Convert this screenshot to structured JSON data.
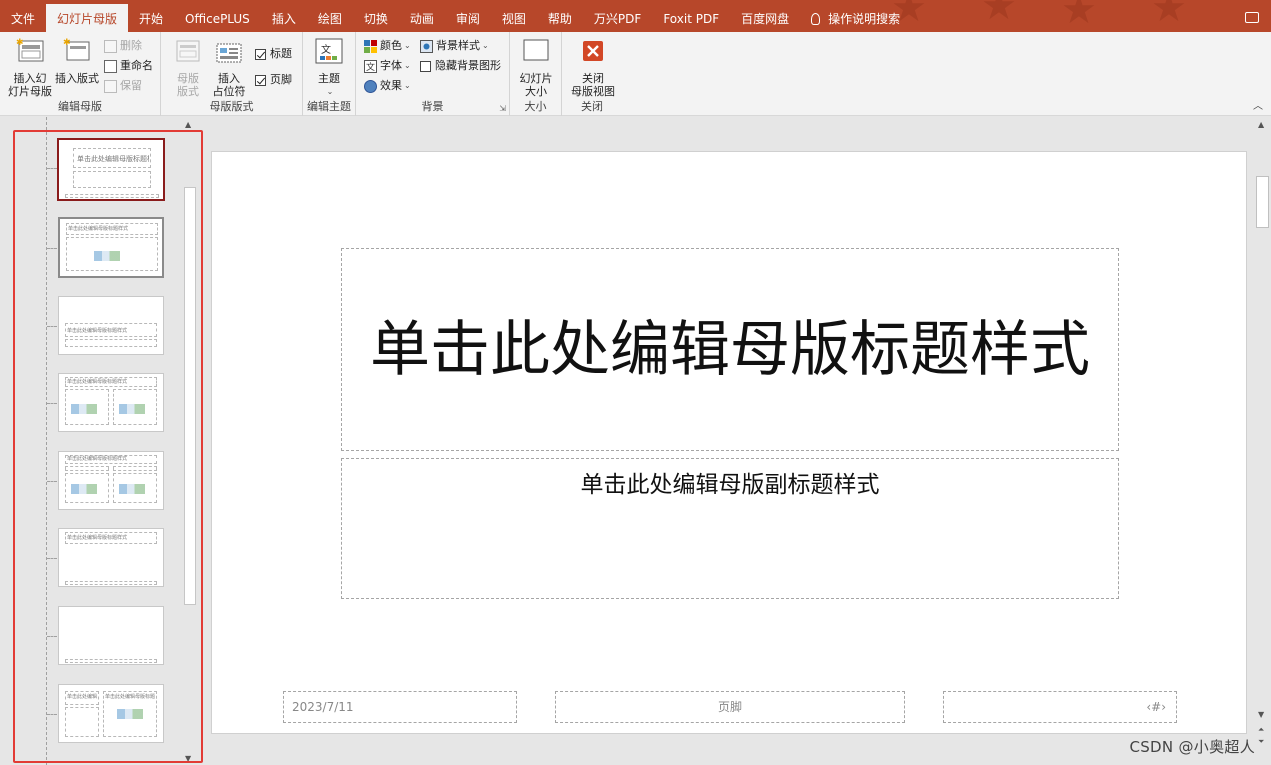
{
  "menu": {
    "tabs": [
      "文件",
      "幻灯片母版",
      "开始",
      "OfficePLUS",
      "插入",
      "绘图",
      "切换",
      "动画",
      "审阅",
      "视图",
      "帮助",
      "万兴PDF",
      "Foxit PDF",
      "百度网盘",
      "操作说明搜索"
    ],
    "active_tab": "幻灯片母版"
  },
  "ribbon": {
    "edit_master": {
      "label": "编辑母版",
      "insert_master": "插入幻\n灯片母版",
      "insert_layout": "插入版式",
      "delete": "删除",
      "rename": "重命名",
      "preserve": "保留"
    },
    "master_layout": {
      "label": "母版版式",
      "master_layout_btn": "母版\n版式",
      "insert_placeholder": "插入\n占位符",
      "title_chk": "标题",
      "footer_chk": "页脚"
    },
    "edit_theme": {
      "label": "编辑主题",
      "theme": "主题"
    },
    "background": {
      "label": "背景",
      "colors": "颜色",
      "fonts": "字体",
      "effects": "效果",
      "bg_styles": "背景样式",
      "hide_bg": "隐藏背景图形"
    },
    "size": {
      "label": "大小",
      "slide_size": "幻灯片\n大小"
    },
    "close": {
      "label": "关闭",
      "close_master": "关闭\n母版视图"
    }
  },
  "thumbnails": {
    "master_title": "单击此处编辑母版标题样式",
    "layout_title": "单击此处编辑母版标题样式"
  },
  "slide": {
    "title": "单击此处编辑母版标题样式",
    "subtitle": "单击此处编辑母版副标题样式",
    "date": "2023/7/11",
    "footer": "页脚",
    "number": "‹#›"
  },
  "watermark": "CSDN @小奥超人",
  "colors": {
    "accent": "#b7472a",
    "highlight_frame": "#e23b35",
    "master_border": "#8a1c1c"
  }
}
